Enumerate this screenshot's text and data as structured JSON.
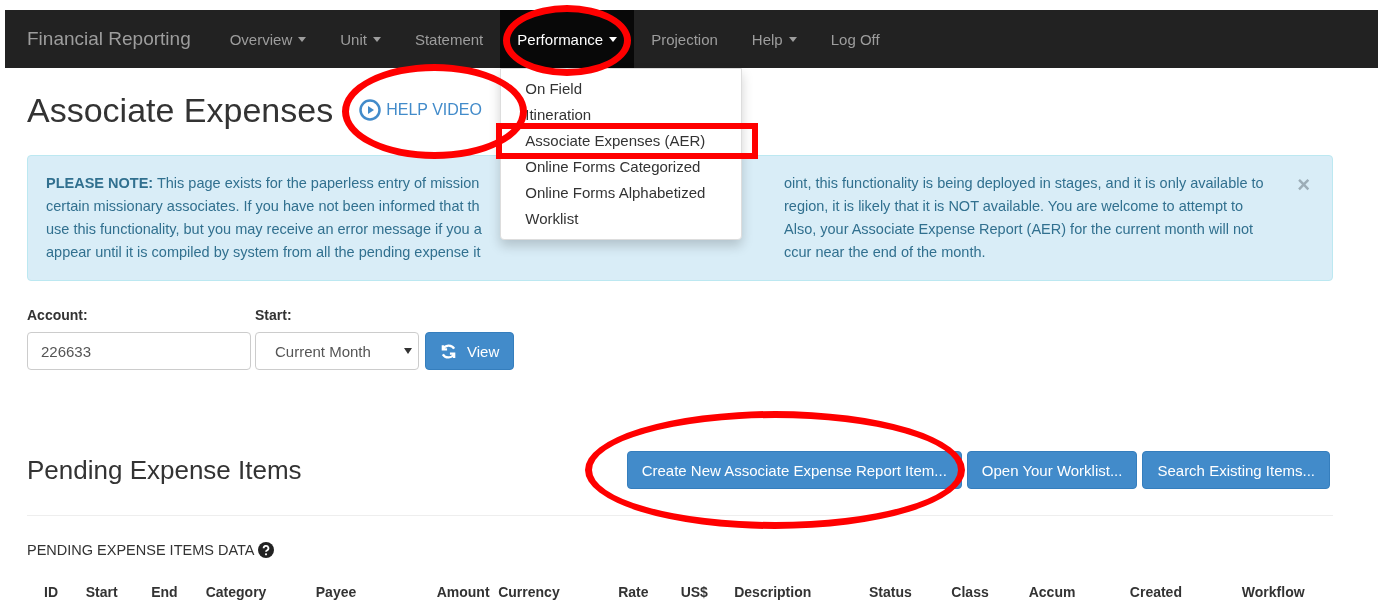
{
  "navbar": {
    "brand": "Financial Reporting",
    "items": [
      {
        "label": "Overview",
        "dropdown": true,
        "selected": false,
        "circled": false
      },
      {
        "label": "Unit",
        "dropdown": true,
        "selected": false,
        "circled": false
      },
      {
        "label": "Statement",
        "dropdown": false,
        "selected": false,
        "circled": false
      },
      {
        "label": "Performance",
        "dropdown": true,
        "selected": true,
        "circled": true
      },
      {
        "label": "Projection",
        "dropdown": false,
        "selected": false,
        "circled": false
      },
      {
        "label": "Help",
        "dropdown": true,
        "selected": false,
        "circled": false
      },
      {
        "label": "Log Off",
        "dropdown": false,
        "selected": false,
        "circled": false
      }
    ]
  },
  "dropdown_menu": {
    "items": [
      {
        "label": "On Field",
        "boxed": false
      },
      {
        "label": "Itineration",
        "boxed": false
      },
      {
        "label": "Associate Expenses (AER)",
        "boxed": true
      },
      {
        "label": "Online Forms Categorized",
        "boxed": false
      },
      {
        "label": "Online Forms Alphabetized",
        "boxed": false
      },
      {
        "label": "Worklist",
        "boxed": false
      }
    ]
  },
  "page": {
    "title": "Associate Expenses",
    "help_link": {
      "label": "HELP VIDEO",
      "circled": true
    }
  },
  "alert": {
    "close": "×",
    "lines": [
      {
        "left": "**PLEASE NOTE:** This page exists for the paperless entry of mission",
        "right": "oint, this functionality is being deployed in stages, and it is only available to"
      },
      {
        "left": "certain missionary associates. If you have not been informed that th",
        "right": "region, it is likely that it is NOT available. You are welcome to attempt to"
      },
      {
        "left": "use this functionality, but you may receive an error message if you a",
        "right": "Also, your Associate Expense Report (AER) for the current month will not"
      },
      {
        "left": "appear until it is compiled by system from all the pending expense it",
        "right": "ccur near the end of the month."
      }
    ]
  },
  "form": {
    "account": {
      "label": "Account:",
      "value": "226633"
    },
    "start": {
      "label": "Start:",
      "value": "Current Month"
    },
    "view_button": "View"
  },
  "pending": {
    "title": "Pending Expense Items",
    "buttons": [
      {
        "label": "Create New Associate Expense Report Item...",
        "circled": true
      },
      {
        "label": "Open Your Worklist...",
        "circled": false
      },
      {
        "label": "Search Existing Items...",
        "circled": false
      }
    ],
    "data_label": "PENDING EXPENSE ITEMS DATA",
    "table": {
      "columns": [
        "ID",
        "Start",
        "End",
        "Category",
        "Payee",
        "Amount",
        "Currency",
        "Rate",
        "US$",
        "Description",
        "Status",
        "Class",
        "Accum",
        "Created",
        "Workflow"
      ]
    }
  }
}
